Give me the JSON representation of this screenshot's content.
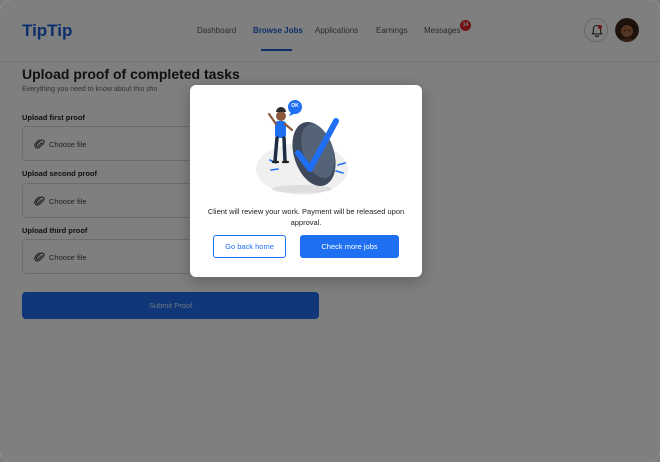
{
  "header": {
    "logo": "TipTip",
    "nav": [
      {
        "label": "Dashboard",
        "active": false
      },
      {
        "label": "Browse Jobs",
        "active": true
      },
      {
        "label": "Applications",
        "active": false
      },
      {
        "label": "Earnings",
        "active": false
      },
      {
        "label": "Messages",
        "active": false
      }
    ],
    "messages_badge": "14",
    "icons": {
      "notifications": "bell-icon",
      "profile": "avatar"
    }
  },
  "main": {
    "title": "Upload proof of completed tasks",
    "subtitle": "Everything you need to know about this sho",
    "fields": [
      {
        "label": "Upload first proof",
        "placeholder": "Choose file"
      },
      {
        "label": "Upload second proof",
        "placeholder": "Choose file"
      },
      {
        "label": "Upload third proof",
        "placeholder": "Choose file"
      }
    ],
    "submit_label": "Submit Proof"
  },
  "modal": {
    "illustration_badge": "OK",
    "message": "Client will review your work. Payment will be released upon approval.",
    "secondary_button": "Go back home",
    "primary_button": "Check more jobs"
  },
  "colors": {
    "brand": "#1b5fd6",
    "primary": "#1e6ff2",
    "badge": "#e02424"
  }
}
